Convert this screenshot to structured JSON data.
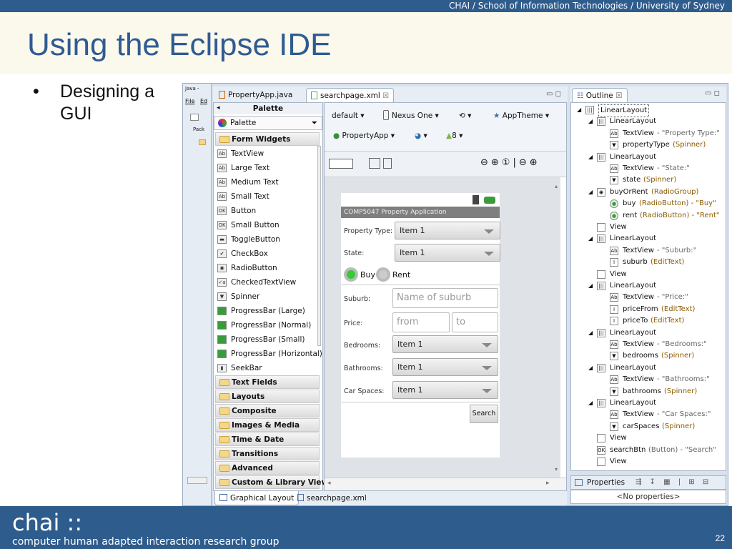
{
  "header": {
    "institution": "CHAI / School of Information Technologies / University of Sydney"
  },
  "slide": {
    "title": "Using the Eclipse IDE",
    "bullet_mark": "•",
    "bullet": "Designing a GUI",
    "page": "22"
  },
  "footer": {
    "brand": "chai ::",
    "subtitle": "computer human adapted interaction research group"
  },
  "ide": {
    "left_strip": {
      "tab": "Java -",
      "menu_file": "File",
      "menu_edit": "Ed",
      "pack": "Pack"
    },
    "editor_tabs": [
      {
        "label": "PropertyApp.java"
      },
      {
        "label": "searchpage.xml"
      }
    ],
    "close_glyph": "☒",
    "toolbar1": {
      "config": "default",
      "device": "Nexus One",
      "theme": "AppTheme"
    },
    "toolbar2": {
      "activity": "PropertyApp",
      "api": "8"
    },
    "palette": {
      "header": "Palette",
      "selector": "Palette",
      "form_widgets": "Form Widgets",
      "items": [
        {
          "label": "TextView",
          "icon": "Ab"
        },
        {
          "label": "Large Text",
          "icon": "Ab"
        },
        {
          "label": "Medium Text",
          "icon": "Ab"
        },
        {
          "label": "Small Text",
          "icon": "Ab"
        },
        {
          "label": "Button",
          "icon": "OK"
        },
        {
          "label": "Small Button",
          "icon": "OK"
        },
        {
          "label": "ToggleButton",
          "icon": "▬"
        },
        {
          "label": "CheckBox",
          "icon": "✔"
        },
        {
          "label": "RadioButton",
          "icon": "◉"
        },
        {
          "label": "CheckedTextView",
          "icon": "✓a"
        },
        {
          "label": "Spinner",
          "icon": "▼"
        },
        {
          "label": "ProgressBar (Large)",
          "icon": "▬"
        },
        {
          "label": "ProgressBar (Normal)",
          "icon": "▬"
        },
        {
          "label": "ProgressBar (Small)",
          "icon": "▬"
        },
        {
          "label": "ProgressBar (Horizontal)",
          "icon": "▬"
        },
        {
          "label": "SeekBar",
          "icon": "▮"
        }
      ],
      "categories": [
        "Text Fields",
        "Layouts",
        "Composite",
        "Images & Media",
        "Time & Date",
        "Transitions",
        "Advanced",
        "Custom & Library Views"
      ]
    },
    "device": {
      "app_title": "COMP5047 Property Application",
      "property_type_label": "Property Type:",
      "property_type_value": "Item 1",
      "state_label": "State:",
      "state_value": "Item 1",
      "buy": "Buy",
      "rent": "Rent",
      "suburb_label": "Suburb:",
      "suburb_hint": "Name of suburb",
      "price_label": "Price:",
      "from_hint": "from",
      "to_hint": "to",
      "bedrooms_label": "Bedrooms:",
      "bedrooms_value": "Item 1",
      "bathrooms_label": "Bathrooms:",
      "bathrooms_value": "Item 1",
      "carspaces_label": "Car Spaces:",
      "carspaces_value": "Item 1",
      "search_button": "Search"
    },
    "bottom_tabs": [
      {
        "label": "Graphical Layout"
      },
      {
        "label": "searchpage.xml"
      }
    ],
    "outline": {
      "title": "Outline",
      "items": [
        {
          "name": "LinearLayout",
          "detail": "",
          "icon": "layout"
        },
        {
          "name": "LinearLayout",
          "detail": "",
          "icon": "layout"
        },
        {
          "name": "TextView",
          "detail": "- \"Property Type:\"",
          "icon": "Ab"
        },
        {
          "name": "propertyType",
          "detail": "(Spinner)",
          "icon": "spin"
        },
        {
          "name": "LinearLayout",
          "detail": "",
          "icon": "layout"
        },
        {
          "name": "TextView",
          "detail": "- \"State:\"",
          "icon": "Ab"
        },
        {
          "name": "state",
          "detail": "(Spinner)",
          "icon": "spin"
        },
        {
          "name": "buyOrRent",
          "detail": "(RadioGroup)",
          "icon": "radiogroup"
        },
        {
          "name": "buy",
          "detail": "(RadioButton) - \"Buy\"",
          "icon": "radio"
        },
        {
          "name": "rent",
          "detail": "(RadioButton) - \"Rent\"",
          "icon": "radio"
        },
        {
          "name": "View",
          "detail": "",
          "icon": "view"
        },
        {
          "name": "LinearLayout",
          "detail": "",
          "icon": "layout"
        },
        {
          "name": "TextView",
          "detail": "- \"Suburb:\"",
          "icon": "Ab"
        },
        {
          "name": "suburb",
          "detail": "(EditText)",
          "icon": "edit"
        },
        {
          "name": "View",
          "detail": "",
          "icon": "view"
        },
        {
          "name": "LinearLayout",
          "detail": "",
          "icon": "layout"
        },
        {
          "name": "TextView",
          "detail": "- \"Price:\"",
          "icon": "Ab"
        },
        {
          "name": "priceFrom",
          "detail": "(EditText)",
          "icon": "edit"
        },
        {
          "name": "priceTo",
          "detail": "(EditText)",
          "icon": "edit"
        },
        {
          "name": "LinearLayout",
          "detail": "",
          "icon": "layout"
        },
        {
          "name": "TextView",
          "detail": "- \"Bedrooms:\"",
          "icon": "Ab"
        },
        {
          "name": "bedrooms",
          "detail": "(Spinner)",
          "icon": "spin"
        },
        {
          "name": "LinearLayout",
          "detail": "",
          "icon": "layout"
        },
        {
          "name": "TextView",
          "detail": "- \"Bathrooms:\"",
          "icon": "Ab"
        },
        {
          "name": "bathrooms",
          "detail": "(Spinner)",
          "icon": "spin"
        },
        {
          "name": "LinearLayout",
          "detail": "",
          "icon": "layout"
        },
        {
          "name": "TextView",
          "detail": "- \"Car Spaces:\"",
          "icon": "Ab"
        },
        {
          "name": "carSpaces",
          "detail": "(Spinner)",
          "icon": "spin"
        },
        {
          "name": "View",
          "detail": "",
          "icon": "view"
        },
        {
          "name": "searchBtn",
          "detail": "(Button) - \"Search\"",
          "icon": "ok"
        },
        {
          "name": "View",
          "detail": "",
          "icon": "view"
        }
      ]
    },
    "properties": {
      "tab": "Properties",
      "empty": "<No properties>"
    }
  }
}
